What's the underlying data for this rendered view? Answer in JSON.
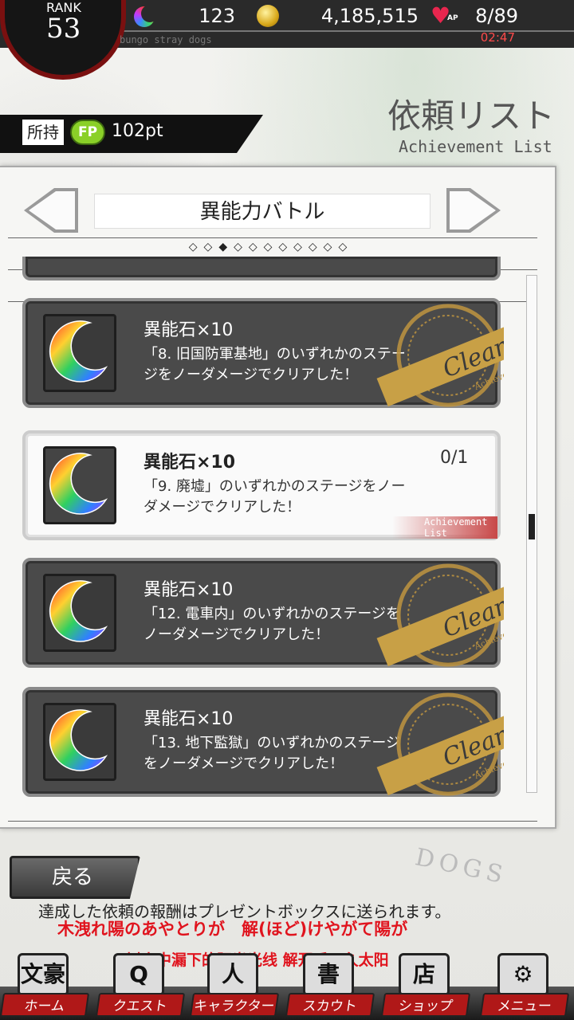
{
  "status": {
    "rank_label": "RANK",
    "rank_value": "53",
    "stones": "123",
    "money": "4,185,515",
    "ap_label": "AP",
    "ap": "8/89",
    "timer": "02:47",
    "subtitle": "bungo stray dogs"
  },
  "header": {
    "title_ja": "依頼リスト",
    "title_en": "Achievement List"
  },
  "fp": {
    "own_label": "所持",
    "icon_label": "FP",
    "value": "102pt"
  },
  "category": {
    "title": "異能力バトル",
    "page_dots": "◇◇◆◇◇◇◇◇◇◇◇"
  },
  "cards": [
    {
      "reward": "異能石×10",
      "desc": "「8. 旧国防軍基地」のいずれかのステージをノーダメージでクリアした！",
      "state": "clear"
    },
    {
      "reward": "異能石×10",
      "desc": "「9. 廃墟」のいずれかのステージをノーダメージでクリアした！",
      "progress": "0/1",
      "footer": "Achievement List",
      "state": "active"
    },
    {
      "reward": "異能石×10",
      "desc": "「12. 電車内」のいずれかのステージをノーダメージでクリアした！",
      "state": "clear"
    },
    {
      "reward": "異能石×10",
      "desc": "「13. 地下監獄」のいずれかのステージをノーダメージでクリアした！",
      "state": "clear"
    }
  ],
  "seal": {
    "text": "Clear",
    "sub": "Achievement"
  },
  "back_label": "戻る",
  "notice": "達成した依頼の報酬はプレゼントボックスに送られます。",
  "subtitles": {
    "line1": "木洩れ陽のあやとりが　解(ほど)けやがて陽が",
    "line2": "树木中漏下的阳光光线 解开后不久太阳"
  },
  "deco": "DOGS",
  "nav": [
    {
      "label": "ホーム",
      "icon": "文豪"
    },
    {
      "label": "クエスト",
      "icon": "Q"
    },
    {
      "label": "キャラクター",
      "icon": "人"
    },
    {
      "label": "スカウト",
      "icon": "書"
    },
    {
      "label": "ショップ",
      "icon": "店"
    },
    {
      "label": "メニュー",
      "icon": "⚙"
    }
  ],
  "colors": {
    "accent_red": "#b01818",
    "subtitle_red": "#e0141e",
    "seal_gold": "#c8a046"
  }
}
